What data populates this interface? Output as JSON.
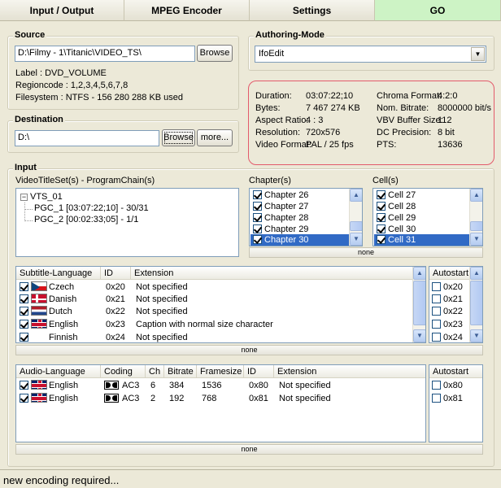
{
  "tabs": [
    {
      "label": "Input / Output"
    },
    {
      "label": "MPEG Encoder"
    },
    {
      "label": "Settings"
    },
    {
      "label": "GO"
    }
  ],
  "source": {
    "title": "Source",
    "path": "D:\\Filmy - 1\\Titanic\\VIDEO_TS\\",
    "browse_label": "Browse",
    "label_line": "Label :        DVD_VOLUME",
    "regioncode_line": "Regioncode : 1,2,3,4,5,6,7,8",
    "filesystem_line": "Filesystem :  NTFS - 156 280 288 KB used"
  },
  "destination": {
    "title": "Destination",
    "path": "D:\\",
    "browse_label": "Browse",
    "more_label": "more..."
  },
  "authoring": {
    "title": "Authoring-Mode",
    "selected": "IfoEdit"
  },
  "info": {
    "left": [
      {
        "label": "Duration:",
        "value": "03:07:22;10"
      },
      {
        "label": "Bytes:",
        "value": "7 467 274 KB"
      },
      {
        "label": "Aspect Ratio:",
        "value": "4 : 3"
      },
      {
        "label": "Resolution:",
        "value": "720x576"
      },
      {
        "label": "Video Format:",
        "value": "PAL / 25 fps"
      }
    ],
    "right": [
      {
        "label": "Chroma Format:",
        "value": "4:2:0"
      },
      {
        "label": "Nom. Bitrate:",
        "value": "8000000 bit/s"
      },
      {
        "label": "VBV Buffer Size:",
        "value": "112"
      },
      {
        "label": "DC Precision:",
        "value": "8 bit"
      },
      {
        "label": "PTS:",
        "value": "13636"
      }
    ]
  },
  "input": {
    "title": "Input",
    "tree_label": "VideoTitleSet(s) - ProgramChain(s)",
    "tree": {
      "root": "VTS_01",
      "children": [
        "PGC_1 [03:07:22;10] - 30/31",
        "PGC_2 [00:02:33;05] - 1/1"
      ]
    },
    "chapters_label": "Chapter(s)",
    "chapters": [
      "Chapter 26",
      "Chapter 27",
      "Chapter 28",
      "Chapter 29",
      "Chapter 30"
    ],
    "cells_label": "Cell(s)",
    "cells": [
      "Cell 27",
      "Cell 28",
      "Cell 29",
      "Cell 30",
      "Cell 31"
    ],
    "none_label": "none"
  },
  "subtitles": {
    "headers": [
      "Subtitle-Language",
      "ID",
      "Extension"
    ],
    "rows": [
      {
        "lang": "Czech",
        "flag": "cz",
        "id": "0x20",
        "ext": "Not specified"
      },
      {
        "lang": "Danish",
        "flag": "dk",
        "id": "0x21",
        "ext": "Not specified"
      },
      {
        "lang": "Dutch",
        "flag": "nl",
        "id": "0x22",
        "ext": "Not specified"
      },
      {
        "lang": "English",
        "flag": "uk",
        "id": "0x23",
        "ext": "Caption with normal size character"
      },
      {
        "lang": "Finnish",
        "flag": "",
        "id": "0x24",
        "ext": "Not specified"
      }
    ],
    "autostart_header": "Autostart",
    "autostart": [
      "0x20",
      "0x21",
      "0x22",
      "0x23",
      "0x24"
    ],
    "none_label": "none"
  },
  "audio": {
    "headers": [
      "Audio-Language",
      "Coding",
      "Ch",
      "Bitrate",
      "Framesize",
      "ID",
      "Extension"
    ],
    "rows": [
      {
        "lang": "English",
        "coding": "AC3",
        "ch": "6",
        "bitrate": "384",
        "framesize": "1536",
        "id": "0x80",
        "ext": "Not specified"
      },
      {
        "lang": "English",
        "coding": "AC3",
        "ch": "2",
        "bitrate": "192",
        "framesize": "768",
        "id": "0x81",
        "ext": "Not specified"
      }
    ],
    "autostart_header": "Autostart",
    "autostart": [
      "0x80",
      "0x81"
    ],
    "none_label": "none"
  },
  "status": {
    "text": "new encoding required..."
  },
  "icons": [
    "checkbox-icon",
    "flag-icon",
    "dolby-icon",
    "scroll-up-icon",
    "scroll-down-icon",
    "dropdown-arrow-icon"
  ]
}
